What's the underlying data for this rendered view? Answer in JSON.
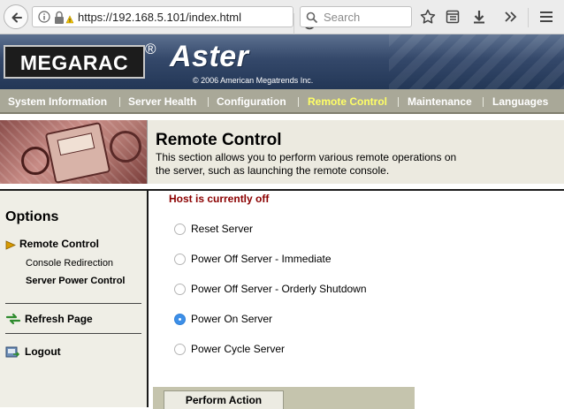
{
  "browser": {
    "url": "https://192.168.5.101/index.html",
    "search_placeholder": "Search"
  },
  "header": {
    "logo": "MEGARAC",
    "logo_mark": "®",
    "product": "Aster",
    "copyright": "© 2006 American Megatrends Inc."
  },
  "nav": {
    "items": [
      "System Information",
      "Server Health",
      "Configuration",
      "Remote Control",
      "Maintenance",
      "Languages"
    ],
    "active": "Remote Control"
  },
  "page": {
    "title": "Remote Control",
    "description": "This section allows you to perform various remote operations on the server, such as launching the remote console."
  },
  "sidebar": {
    "heading": "Options",
    "section": "Remote Control",
    "sub_items": [
      "Console Redirection",
      "Server Power Control"
    ],
    "refresh": "Refresh Page",
    "logout": "Logout"
  },
  "main": {
    "status": "Host is currently off",
    "options": [
      {
        "label": "Reset Server",
        "selected": false
      },
      {
        "label": "Power Off Server - Immediate",
        "selected": false
      },
      {
        "label": "Power Off Server - Orderly Shutdown",
        "selected": false
      },
      {
        "label": "Power On Server",
        "selected": true
      },
      {
        "label": "Power Cycle Server",
        "selected": false
      }
    ],
    "action_button": "Perform Action"
  },
  "colors": {
    "status_text": "#8b0000",
    "nav_active": "#ffff66",
    "nav_bar": "#a9a898",
    "radio_selected": "#3d8fe8"
  }
}
